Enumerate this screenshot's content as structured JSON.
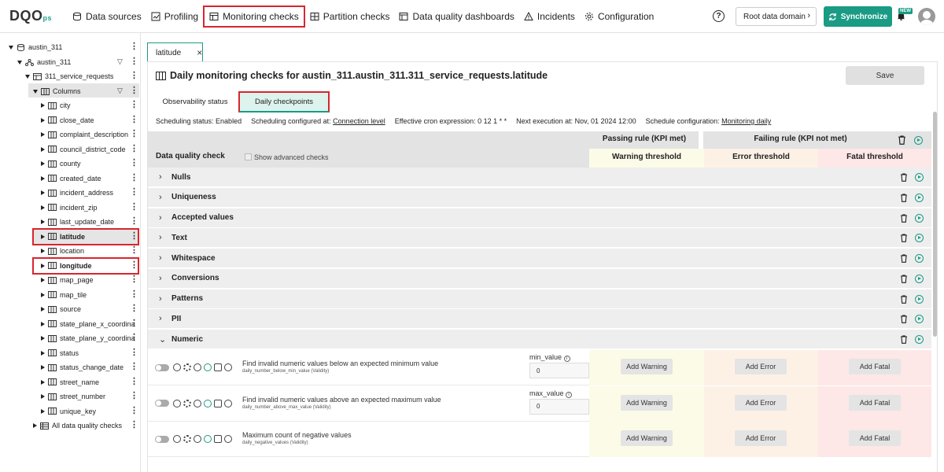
{
  "app": {
    "logo_text": "DQO",
    "logo_sub": "ps"
  },
  "nav": {
    "items": [
      {
        "label": "Data sources",
        "icon": "database-icon"
      },
      {
        "label": "Profiling",
        "icon": "profiling-icon"
      },
      {
        "label": "Monitoring checks",
        "icon": "table-icon",
        "active": true
      },
      {
        "label": "Partition checks",
        "icon": "partition-icon"
      },
      {
        "label": "Data quality dashboards",
        "icon": "dashboard-icon"
      },
      {
        "label": "Incidents",
        "icon": "warning-icon"
      },
      {
        "label": "Configuration",
        "icon": "gear-icon"
      }
    ],
    "help": "?",
    "root_domain": "Root data domain",
    "sync_label": "Synchronize",
    "new_badge": "NEW"
  },
  "tree": {
    "connection": "austin_311",
    "schema": "austin_311",
    "table": "311_service_requests",
    "columns_label": "Columns",
    "columns": [
      "city",
      "close_date",
      "complaint_description",
      "council_district_code",
      "county",
      "created_date",
      "incident_address",
      "incident_zip",
      "last_update_date",
      "latitude",
      "location",
      "longitude",
      "map_page",
      "map_tile",
      "source",
      "state_plane_x_coordina",
      "state_plane_y_coordina",
      "status",
      "status_change_date",
      "street_name",
      "street_number",
      "unique_key"
    ],
    "all_checks": "All data quality checks"
  },
  "tab": {
    "label": "latitude",
    "close": "×"
  },
  "page": {
    "title": "Daily monitoring checks for austin_311.austin_311.311_service_requests.latitude",
    "save_label": "Save",
    "subtabs": [
      "Observability status",
      "Daily checkpoints"
    ]
  },
  "info": {
    "scheduling_status": "Scheduling status: Enabled",
    "configured_at_label": "Scheduling configured at:",
    "configured_at_value": "Connection level",
    "cron": "Effective cron expression: 0 12 1 * *",
    "next_exec": "Next execution at: Nov, 01 2024 12:00",
    "schedule_config_label": "Schedule configuration:",
    "schedule_config_value": "Monitoring daily"
  },
  "grid": {
    "check_header": "Data quality check",
    "advanced_label": "Show advanced checks",
    "passing_rule": "Passing rule (KPI met)",
    "failing_rule": "Failing rule (KPI not met)",
    "warning_threshold": "Warning threshold",
    "error_threshold": "Error threshold",
    "fatal_threshold": "Fatal threshold",
    "categories": [
      "Nulls",
      "Uniqueness",
      "Accepted values",
      "Text",
      "Whitespace",
      "Conversions",
      "Patterns",
      "PII",
      "Numeric"
    ],
    "checks": [
      {
        "title": "Find invalid numeric values below an expected minimum value",
        "sub": "daily_number_below_min_value (Validity)",
        "param_label": "min_value",
        "param_value": "0"
      },
      {
        "title": "Find invalid numeric values above an expected maximum value",
        "sub": "daily_number_above_max_value (Validity)",
        "param_label": "max_value",
        "param_value": "0"
      },
      {
        "title": "Maximum count of negative values",
        "sub": "daily_negative_values (Validity)",
        "param_label": "",
        "param_value": ""
      }
    ],
    "add_warning": "Add Warning",
    "add_error": "Add Error",
    "add_fatal": "Add Fatal"
  }
}
